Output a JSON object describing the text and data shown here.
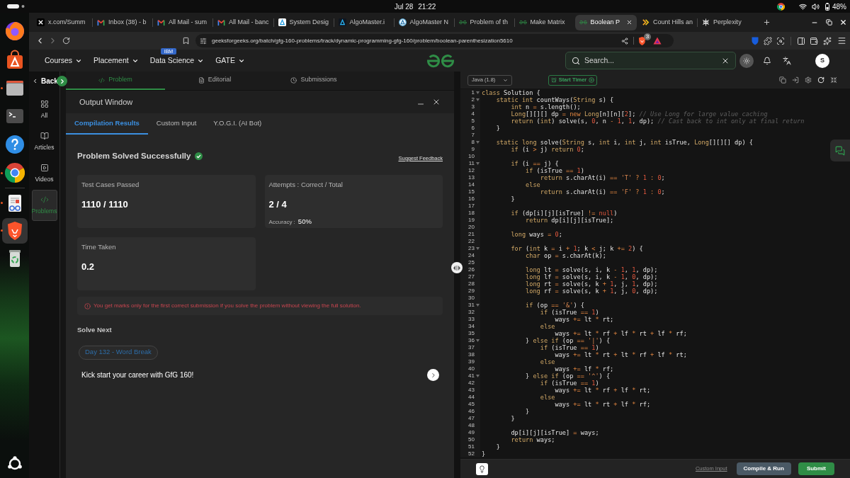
{
  "top_bar": {
    "date": "Jul 28",
    "time": "21:22",
    "battery": "48%"
  },
  "dock": {
    "pinned": [
      {
        "kind": "fox",
        "running": false,
        "selected": false
      },
      {
        "kind": "bag",
        "running": false,
        "selected": false
      },
      {
        "kind": "folder",
        "running": true,
        "selected": false
      },
      {
        "kind": "terminal",
        "running": false,
        "selected": false
      },
      {
        "kind": "help",
        "running": false,
        "selected": false
      },
      {
        "kind": "rings",
        "running": true,
        "selected": false
      }
    ],
    "others": [
      {
        "kind": "reader",
        "running": true,
        "selected": false
      },
      {
        "kind": "lion",
        "running": true,
        "selected": true
      },
      {
        "kind": "bin",
        "running": false,
        "selected": false
      }
    ]
  },
  "browser": {
    "tabs": [
      {
        "title": "x.com/Summ",
        "kind": "x",
        "selected": false
      },
      {
        "title": "Inbox (38) - b",
        "kind": "mail",
        "selected": false
      },
      {
        "title": "All Mail - sum",
        "kind": "mail",
        "selected": false
      },
      {
        "title": "All Mail - banc",
        "kind": "mail",
        "selected": false
      },
      {
        "title": "System Desig",
        "kind": "a-tile",
        "selected": false
      },
      {
        "title": "AlgoMaster.i",
        "kind": "a-dark",
        "selected": false
      },
      {
        "title": "AlgoMaster N",
        "kind": "a-ring",
        "selected": false
      },
      {
        "title": "Problem of th",
        "kind": "gfg",
        "selected": false
      },
      {
        "title": "Make Matrix",
        "kind": "gfg",
        "selected": false
      },
      {
        "title": "Boolean P",
        "kind": "gfg",
        "selected": true
      },
      {
        "title": "Count Hills an",
        "kind": "hills",
        "selected": false
      },
      {
        "title": "Perplexity",
        "kind": "burst",
        "selected": false
      }
    ],
    "url": "geeksforgeeks.org/batch/gfg-160-problems/track/dynamic-programming-gfg-160/problem/boolean-parenthesization5610",
    "shield_count": "3"
  },
  "site_nav": {
    "menus": [
      {
        "label": "Courses"
      },
      {
        "label": "Placement"
      },
      {
        "label": "Data Science",
        "badge": "IBM"
      },
      {
        "label": "GATE"
      }
    ],
    "search": {
      "placeholder": "Search..."
    },
    "avatar": "S"
  },
  "side_nav": {
    "back": "Back",
    "items": [
      {
        "label": "All",
        "kind": "grid",
        "selected": false
      },
      {
        "label": "Articles",
        "kind": "book",
        "selected": false
      },
      {
        "label": "Videos",
        "kind": "video",
        "selected": false
      },
      {
        "label": "Problems",
        "kind": "code",
        "selected": true
      }
    ]
  },
  "problem_tabs": [
    {
      "label": "Problem",
      "kind": "code",
      "selected": true
    },
    {
      "label": "Editorial",
      "kind": "doc",
      "selected": false
    },
    {
      "label": "Submissions",
      "kind": "clock",
      "selected": false
    }
  ],
  "output_window": {
    "title": "Output Window",
    "tabs": [
      {
        "label": "Compilation Results",
        "selected": true
      },
      {
        "label": "Custom Input",
        "selected": false
      },
      {
        "label": "Y.O.G.I. (AI Bot)",
        "selected": false
      }
    ],
    "status": "Problem Solved Successfully",
    "feedback_link": "Suggest Feedback",
    "cards": [
      {
        "label": "Test Cases Passed",
        "value": "1110 / 1110"
      },
      {
        "label": "Attempts : Correct / Total",
        "value": "2 / 4",
        "detail_label": "Accuracy :",
        "detail_value": "50%"
      },
      {
        "label": "Time Taken",
        "value": "0.2"
      }
    ],
    "warning": "You get marks only for the first correct submission if you solve the problem without viewing the full solution.",
    "solve_next": {
      "heading": "Solve Next",
      "chip": "Day 132 - Word Break"
    },
    "promo": "Kick start your career with GfG 160!"
  },
  "editor": {
    "language": "Java (1.8)",
    "timer_button": "Start Timer",
    "lines": [
      {
        "number": "1",
        "fold": true,
        "tokens": [
          {
            "kind": "kw",
            "text": "class"
          },
          {
            "kind": "txt",
            "text": " Solution {"
          }
        ]
      },
      {
        "number": "2",
        "fold": true,
        "tokens": [
          {
            "kind": "kw",
            "text": "    static int"
          },
          {
            "kind": "txt",
            "text": " countWays("
          },
          {
            "kind": "kw",
            "text": "String"
          },
          {
            "kind": "txt",
            "text": " s) {"
          }
        ]
      },
      {
        "number": "3",
        "fold": false,
        "tokens": [
          {
            "kind": "kw",
            "text": "        int"
          },
          {
            "kind": "txt",
            "text": " n "
          },
          {
            "kind": "op",
            "text": "="
          },
          {
            "kind": "txt",
            "text": " s.length();"
          }
        ]
      },
      {
        "number": "4",
        "fold": false,
        "tokens": [
          {
            "kind": "kw",
            "text": "        Long"
          },
          {
            "kind": "txt",
            "text": "[][][] dp "
          },
          {
            "kind": "op",
            "text": "= new "
          },
          {
            "kind": "kw",
            "text": "Long"
          },
          {
            "kind": "txt",
            "text": "[n][n]["
          },
          {
            "kind": "num",
            "text": "2"
          },
          {
            "kind": "txt",
            "text": "]; "
          },
          {
            "kind": "cmt",
            "text": "// Use Long for large value caching"
          }
        ]
      },
      {
        "number": "5",
        "fold": false,
        "tokens": [
          {
            "kind": "kw",
            "text": "        return"
          },
          {
            "kind": "txt",
            "text": " ("
          },
          {
            "kind": "kw",
            "text": "int"
          },
          {
            "kind": "txt",
            "text": ") solve(s, "
          },
          {
            "kind": "num",
            "text": "0"
          },
          {
            "kind": "txt",
            "text": ", n "
          },
          {
            "kind": "op",
            "text": "- "
          },
          {
            "kind": "num",
            "text": "1"
          },
          {
            "kind": "txt",
            "text": ", "
          },
          {
            "kind": "num",
            "text": "1"
          },
          {
            "kind": "txt",
            "text": ", dp); "
          },
          {
            "kind": "cmt",
            "text": "// Cast back to int only at final return"
          }
        ]
      },
      {
        "number": "6",
        "fold": false,
        "tokens": [
          {
            "kind": "txt",
            "text": "    }"
          }
        ]
      },
      {
        "number": "7",
        "fold": false
      },
      {
        "number": "8",
        "fold": true,
        "tokens": [
          {
            "kind": "kw",
            "text": "    static long"
          },
          {
            "kind": "txt",
            "text": " solve("
          },
          {
            "kind": "kw",
            "text": "String"
          },
          {
            "kind": "txt",
            "text": " s, "
          },
          {
            "kind": "kw",
            "text": "int"
          },
          {
            "kind": "txt",
            "text": " i, "
          },
          {
            "kind": "kw",
            "text": "int"
          },
          {
            "kind": "txt",
            "text": " j, "
          },
          {
            "kind": "kw",
            "text": "int"
          },
          {
            "kind": "txt",
            "text": " isTrue, "
          },
          {
            "kind": "kw",
            "text": "Long"
          },
          {
            "kind": "txt",
            "text": "[][][] dp) {"
          }
        ]
      },
      {
        "number": "9",
        "fold": false,
        "tokens": [
          {
            "kind": "kw",
            "text": "        if"
          },
          {
            "kind": "txt",
            "text": " (i "
          },
          {
            "kind": "op",
            "text": ">"
          },
          {
            "kind": "txt",
            "text": " j) "
          },
          {
            "kind": "kw",
            "text": "return"
          },
          {
            "kind": "num",
            "text": " 0"
          },
          {
            "kind": "txt",
            "text": ";"
          }
        ]
      },
      {
        "number": "10",
        "fold": false
      },
      {
        "number": "11",
        "fold": true,
        "tokens": [
          {
            "kind": "kw",
            "text": "        if"
          },
          {
            "kind": "txt",
            "text": " (i "
          },
          {
            "kind": "op",
            "text": "=="
          },
          {
            "kind": "txt",
            "text": " j) {"
          }
        ]
      },
      {
        "number": "12",
        "fold": false,
        "tokens": [
          {
            "kind": "kw",
            "text": "            if"
          },
          {
            "kind": "txt",
            "text": " (isTrue "
          },
          {
            "kind": "op",
            "text": "=="
          },
          {
            "kind": "num",
            "text": " 1"
          },
          {
            "kind": "txt",
            "text": ")"
          }
        ]
      },
      {
        "number": "13",
        "fold": false,
        "tokens": [
          {
            "kind": "kw",
            "text": "                return"
          },
          {
            "kind": "txt",
            "text": " s.charAt(i) "
          },
          {
            "kind": "op",
            "text": "=="
          },
          {
            "kind": "str",
            "text": " 'T'"
          },
          {
            "kind": "op",
            "text": " ?"
          },
          {
            "kind": "num",
            "text": " 1"
          },
          {
            "kind": "op",
            "text": " :"
          },
          {
            "kind": "num",
            "text": " 0"
          },
          {
            "kind": "txt",
            "text": ";"
          }
        ]
      },
      {
        "number": "14",
        "fold": false,
        "tokens": [
          {
            "kind": "kw",
            "text": "            else"
          }
        ]
      },
      {
        "number": "15",
        "fold": false,
        "tokens": [
          {
            "kind": "kw",
            "text": "                return"
          },
          {
            "kind": "txt",
            "text": " s.charAt(i) "
          },
          {
            "kind": "op",
            "text": "=="
          },
          {
            "kind": "str",
            "text": " 'F'"
          },
          {
            "kind": "op",
            "text": " ?"
          },
          {
            "kind": "num",
            "text": " 1"
          },
          {
            "kind": "op",
            "text": " :"
          },
          {
            "kind": "num",
            "text": " 0"
          },
          {
            "kind": "txt",
            "text": ";"
          }
        ]
      },
      {
        "number": "16",
        "fold": false,
        "tokens": [
          {
            "kind": "txt",
            "text": "        }"
          }
        ]
      },
      {
        "number": "17",
        "fold": false
      },
      {
        "number": "18",
        "fold": false,
        "tokens": [
          {
            "kind": "kw",
            "text": "        if"
          },
          {
            "kind": "txt",
            "text": " (dp[i][j][isTrue] "
          },
          {
            "kind": "op",
            "text": "!="
          },
          {
            "kind": "num",
            "text": " null"
          },
          {
            "kind": "txt",
            "text": ")"
          }
        ]
      },
      {
        "number": "19",
        "fold": false,
        "tokens": [
          {
            "kind": "kw",
            "text": "            return"
          },
          {
            "kind": "txt",
            "text": " dp[i][j][isTrue];"
          }
        ]
      },
      {
        "number": "20",
        "fold": false
      },
      {
        "number": "21",
        "fold": false,
        "tokens": [
          {
            "kind": "kw",
            "text": "        long"
          },
          {
            "kind": "txt",
            "text": " ways "
          },
          {
            "kind": "op",
            "text": "="
          },
          {
            "kind": "num",
            "text": " 0"
          },
          {
            "kind": "txt",
            "text": ";"
          }
        ]
      },
      {
        "number": "22",
        "fold": false
      },
      {
        "number": "23",
        "fold": true,
        "tokens": [
          {
            "kind": "kw",
            "text": "        for"
          },
          {
            "kind": "txt",
            "text": " ("
          },
          {
            "kind": "kw",
            "text": "int"
          },
          {
            "kind": "txt",
            "text": " k "
          },
          {
            "kind": "op",
            "text": "="
          },
          {
            "kind": "txt",
            "text": " i "
          },
          {
            "kind": "op",
            "text": "+"
          },
          {
            "kind": "num",
            "text": " 1"
          },
          {
            "kind": "txt",
            "text": "; k "
          },
          {
            "kind": "op",
            "text": "<"
          },
          {
            "kind": "txt",
            "text": " j; k "
          },
          {
            "kind": "op",
            "text": "+="
          },
          {
            "kind": "num",
            "text": " 2"
          },
          {
            "kind": "txt",
            "text": ") {"
          }
        ]
      },
      {
        "number": "24",
        "fold": false,
        "tokens": [
          {
            "kind": "kw",
            "text": "            char"
          },
          {
            "kind": "txt",
            "text": " op "
          },
          {
            "kind": "op",
            "text": "="
          },
          {
            "kind": "txt",
            "text": " s.charAt(k);"
          }
        ]
      },
      {
        "number": "25",
        "fold": false
      },
      {
        "number": "26",
        "fold": false,
        "tokens": [
          {
            "kind": "kw",
            "text": "            long"
          },
          {
            "kind": "txt",
            "text": " lt "
          },
          {
            "kind": "op",
            "text": "="
          },
          {
            "kind": "txt",
            "text": " solve(s, i, k "
          },
          {
            "kind": "op",
            "text": "-"
          },
          {
            "kind": "num",
            "text": " 1"
          },
          {
            "kind": "txt",
            "text": ", "
          },
          {
            "kind": "num",
            "text": "1"
          },
          {
            "kind": "txt",
            "text": ", dp);"
          }
        ]
      },
      {
        "number": "27",
        "fold": false,
        "tokens": [
          {
            "kind": "kw",
            "text": "            long"
          },
          {
            "kind": "txt",
            "text": " lf "
          },
          {
            "kind": "op",
            "text": "="
          },
          {
            "kind": "txt",
            "text": " solve(s, i, k "
          },
          {
            "kind": "op",
            "text": "-"
          },
          {
            "kind": "num",
            "text": " 1"
          },
          {
            "kind": "txt",
            "text": ", "
          },
          {
            "kind": "num",
            "text": "0"
          },
          {
            "kind": "txt",
            "text": ", dp);"
          }
        ]
      },
      {
        "number": "28",
        "fold": false,
        "tokens": [
          {
            "kind": "kw",
            "text": "            long"
          },
          {
            "kind": "txt",
            "text": " rt "
          },
          {
            "kind": "op",
            "text": "="
          },
          {
            "kind": "txt",
            "text": " solve(s, k "
          },
          {
            "kind": "op",
            "text": "+"
          },
          {
            "kind": "num",
            "text": " 1"
          },
          {
            "kind": "txt",
            "text": ", j, "
          },
          {
            "kind": "num",
            "text": "1"
          },
          {
            "kind": "txt",
            "text": ", dp);"
          }
        ]
      },
      {
        "number": "29",
        "fold": false,
        "tokens": [
          {
            "kind": "kw",
            "text": "            long"
          },
          {
            "kind": "txt",
            "text": " rf "
          },
          {
            "kind": "op",
            "text": "="
          },
          {
            "kind": "txt",
            "text": " solve(s, k "
          },
          {
            "kind": "op",
            "text": "+"
          },
          {
            "kind": "num",
            "text": " 1"
          },
          {
            "kind": "txt",
            "text": ", j, "
          },
          {
            "kind": "num",
            "text": "0"
          },
          {
            "kind": "txt",
            "text": ", dp);"
          }
        ]
      },
      {
        "number": "30",
        "fold": false
      },
      {
        "number": "31",
        "fold": true,
        "tokens": [
          {
            "kind": "kw",
            "text": "            if"
          },
          {
            "kind": "txt",
            "text": " (op "
          },
          {
            "kind": "op",
            "text": "=="
          },
          {
            "kind": "str",
            "text": " '&'"
          },
          {
            "kind": "txt",
            "text": ") {"
          }
        ]
      },
      {
        "number": "32",
        "fold": false,
        "tokens": [
          {
            "kind": "kw",
            "text": "                if"
          },
          {
            "kind": "txt",
            "text": " (isTrue "
          },
          {
            "kind": "op",
            "text": "=="
          },
          {
            "kind": "num",
            "text": " 1"
          },
          {
            "kind": "txt",
            "text": ")"
          }
        ]
      },
      {
        "number": "33",
        "fold": false,
        "tokens": [
          {
            "kind": "txt",
            "text": "                    ways "
          },
          {
            "kind": "op",
            "text": "+="
          },
          {
            "kind": "txt",
            "text": " lt "
          },
          {
            "kind": "op",
            "text": "*"
          },
          {
            "kind": "txt",
            "text": " rt;"
          }
        ]
      },
      {
        "number": "34",
        "fold": false,
        "tokens": [
          {
            "kind": "kw",
            "text": "                else"
          }
        ]
      },
      {
        "number": "35",
        "fold": false,
        "tokens": [
          {
            "kind": "txt",
            "text": "                    ways "
          },
          {
            "kind": "op",
            "text": "+="
          },
          {
            "kind": "txt",
            "text": " lt "
          },
          {
            "kind": "op",
            "text": "*"
          },
          {
            "kind": "txt",
            "text": " rf "
          },
          {
            "kind": "op",
            "text": "+"
          },
          {
            "kind": "txt",
            "text": " lf "
          },
          {
            "kind": "op",
            "text": "*"
          },
          {
            "kind": "txt",
            "text": " rt "
          },
          {
            "kind": "op",
            "text": "+"
          },
          {
            "kind": "txt",
            "text": " lf "
          },
          {
            "kind": "op",
            "text": "*"
          },
          {
            "kind": "txt",
            "text": " rf;"
          }
        ]
      },
      {
        "number": "36",
        "fold": true,
        "tokens": [
          {
            "kind": "txt",
            "text": "            } "
          },
          {
            "kind": "kw",
            "text": "else if"
          },
          {
            "kind": "txt",
            "text": " (op "
          },
          {
            "kind": "op",
            "text": "=="
          },
          {
            "kind": "str",
            "text": " '|'"
          },
          {
            "kind": "txt",
            "text": ") {"
          }
        ]
      },
      {
        "number": "37",
        "fold": false,
        "tokens": [
          {
            "kind": "kw",
            "text": "                if"
          },
          {
            "kind": "txt",
            "text": " (isTrue "
          },
          {
            "kind": "op",
            "text": "=="
          },
          {
            "kind": "num",
            "text": " 1"
          },
          {
            "kind": "txt",
            "text": ")"
          }
        ]
      },
      {
        "number": "38",
        "fold": false,
        "tokens": [
          {
            "kind": "txt",
            "text": "                    ways "
          },
          {
            "kind": "op",
            "text": "+="
          },
          {
            "kind": "txt",
            "text": " lt "
          },
          {
            "kind": "op",
            "text": "*"
          },
          {
            "kind": "txt",
            "text": " rt "
          },
          {
            "kind": "op",
            "text": "+"
          },
          {
            "kind": "txt",
            "text": " lt "
          },
          {
            "kind": "op",
            "text": "*"
          },
          {
            "kind": "txt",
            "text": " rf "
          },
          {
            "kind": "op",
            "text": "+"
          },
          {
            "kind": "txt",
            "text": " lf "
          },
          {
            "kind": "op",
            "text": "*"
          },
          {
            "kind": "txt",
            "text": " rt;"
          }
        ]
      },
      {
        "number": "39",
        "fold": false,
        "tokens": [
          {
            "kind": "kw",
            "text": "                else"
          }
        ]
      },
      {
        "number": "40",
        "fold": false,
        "tokens": [
          {
            "kind": "txt",
            "text": "                    ways "
          },
          {
            "kind": "op",
            "text": "+="
          },
          {
            "kind": "txt",
            "text": " lf "
          },
          {
            "kind": "op",
            "text": "*"
          },
          {
            "kind": "txt",
            "text": " rf;"
          }
        ]
      },
      {
        "number": "41",
        "fold": true,
        "tokens": [
          {
            "kind": "txt",
            "text": "            } "
          },
          {
            "kind": "kw",
            "text": "else if"
          },
          {
            "kind": "txt",
            "text": " (op "
          },
          {
            "kind": "op",
            "text": "=="
          },
          {
            "kind": "str",
            "text": " '^'"
          },
          {
            "kind": "txt",
            "text": ") {"
          }
        ]
      },
      {
        "number": "42",
        "fold": false,
        "tokens": [
          {
            "kind": "kw",
            "text": "                if"
          },
          {
            "kind": "txt",
            "text": " (isTrue "
          },
          {
            "kind": "op",
            "text": "=="
          },
          {
            "kind": "num",
            "text": " 1"
          },
          {
            "kind": "txt",
            "text": ")"
          }
        ]
      },
      {
        "number": "43",
        "fold": false,
        "tokens": [
          {
            "kind": "txt",
            "text": "                    ways "
          },
          {
            "kind": "op",
            "text": "+="
          },
          {
            "kind": "txt",
            "text": " lt "
          },
          {
            "kind": "op",
            "text": "*"
          },
          {
            "kind": "txt",
            "text": " rf "
          },
          {
            "kind": "op",
            "text": "+"
          },
          {
            "kind": "txt",
            "text": " lf "
          },
          {
            "kind": "op",
            "text": "*"
          },
          {
            "kind": "txt",
            "text": " rt;"
          }
        ]
      },
      {
        "number": "44",
        "fold": false,
        "tokens": [
          {
            "kind": "kw",
            "text": "                else"
          }
        ]
      },
      {
        "number": "45",
        "fold": false,
        "tokens": [
          {
            "kind": "txt",
            "text": "                    ways "
          },
          {
            "kind": "op",
            "text": "+="
          },
          {
            "kind": "txt",
            "text": " lt "
          },
          {
            "kind": "op",
            "text": "*"
          },
          {
            "kind": "txt",
            "text": " rt "
          },
          {
            "kind": "op",
            "text": "+"
          },
          {
            "kind": "txt",
            "text": " lf "
          },
          {
            "kind": "op",
            "text": "*"
          },
          {
            "kind": "txt",
            "text": " rf;"
          }
        ]
      },
      {
        "number": "46",
        "fold": false,
        "tokens": [
          {
            "kind": "txt",
            "text": "            }"
          }
        ]
      },
      {
        "number": "47",
        "fold": false,
        "tokens": [
          {
            "kind": "txt",
            "text": "        }"
          }
        ]
      },
      {
        "number": "48",
        "fold": false
      },
      {
        "number": "49",
        "fold": false,
        "tokens": [
          {
            "kind": "txt",
            "text": "        dp[i][j][isTrue] "
          },
          {
            "kind": "op",
            "text": "="
          },
          {
            "kind": "txt",
            "text": " ways;"
          }
        ]
      },
      {
        "number": "50",
        "fold": false,
        "tokens": [
          {
            "kind": "kw",
            "text": "        return"
          },
          {
            "kind": "txt",
            "text": " ways;"
          }
        ]
      },
      {
        "number": "51",
        "fold": false,
        "tokens": [
          {
            "kind": "txt",
            "text": "    }"
          }
        ]
      },
      {
        "number": "52",
        "fold": false,
        "tokens": [
          {
            "kind": "txt",
            "text": "}"
          }
        ]
      }
    ],
    "custom_input_link": "Custom Input",
    "run_button": "Compile & Run",
    "submit_button": "Submit"
  }
}
